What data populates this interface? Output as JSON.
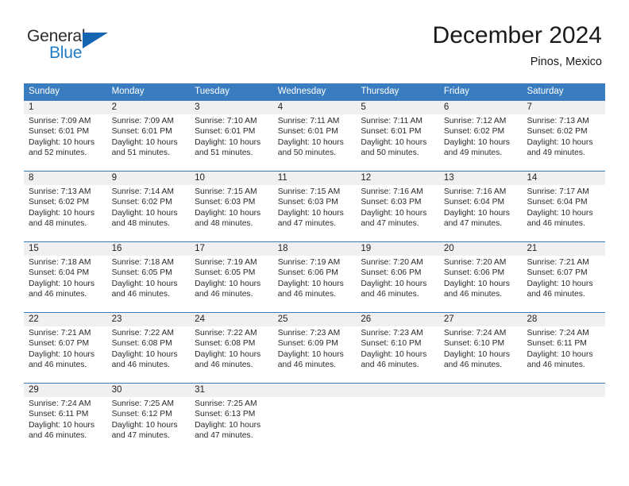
{
  "brand": {
    "name_part1": "General",
    "name_part2": "Blue",
    "triangle_color": "#1565b0",
    "blue_color": "#1f7bc4"
  },
  "header": {
    "title": "December 2024",
    "subtitle": "Pinos, Mexico"
  },
  "theme": {
    "header_blue": "#3a7cc0",
    "daynum_band": "#f0f0f0",
    "text": "#222222"
  },
  "weekdays": [
    "Sunday",
    "Monday",
    "Tuesday",
    "Wednesday",
    "Thursday",
    "Friday",
    "Saturday"
  ],
  "labels": {
    "sunrise_prefix": "Sunrise:",
    "sunset_prefix": "Sunset:",
    "daylight_prefix": "Daylight:"
  },
  "weeks": [
    {
      "days": [
        {
          "num": "1",
          "sunrise": "Sunrise: 7:09 AM",
          "sunset": "Sunset: 6:01 PM",
          "daylight_1": "Daylight: 10 hours",
          "daylight_2": "and 52 minutes."
        },
        {
          "num": "2",
          "sunrise": "Sunrise: 7:09 AM",
          "sunset": "Sunset: 6:01 PM",
          "daylight_1": "Daylight: 10 hours",
          "daylight_2": "and 51 minutes."
        },
        {
          "num": "3",
          "sunrise": "Sunrise: 7:10 AM",
          "sunset": "Sunset: 6:01 PM",
          "daylight_1": "Daylight: 10 hours",
          "daylight_2": "and 51 minutes."
        },
        {
          "num": "4",
          "sunrise": "Sunrise: 7:11 AM",
          "sunset": "Sunset: 6:01 PM",
          "daylight_1": "Daylight: 10 hours",
          "daylight_2": "and 50 minutes."
        },
        {
          "num": "5",
          "sunrise": "Sunrise: 7:11 AM",
          "sunset": "Sunset: 6:01 PM",
          "daylight_1": "Daylight: 10 hours",
          "daylight_2": "and 50 minutes."
        },
        {
          "num": "6",
          "sunrise": "Sunrise: 7:12 AM",
          "sunset": "Sunset: 6:02 PM",
          "daylight_1": "Daylight: 10 hours",
          "daylight_2": "and 49 minutes."
        },
        {
          "num": "7",
          "sunrise": "Sunrise: 7:13 AM",
          "sunset": "Sunset: 6:02 PM",
          "daylight_1": "Daylight: 10 hours",
          "daylight_2": "and 49 minutes."
        }
      ]
    },
    {
      "days": [
        {
          "num": "8",
          "sunrise": "Sunrise: 7:13 AM",
          "sunset": "Sunset: 6:02 PM",
          "daylight_1": "Daylight: 10 hours",
          "daylight_2": "and 48 minutes."
        },
        {
          "num": "9",
          "sunrise": "Sunrise: 7:14 AM",
          "sunset": "Sunset: 6:02 PM",
          "daylight_1": "Daylight: 10 hours",
          "daylight_2": "and 48 minutes."
        },
        {
          "num": "10",
          "sunrise": "Sunrise: 7:15 AM",
          "sunset": "Sunset: 6:03 PM",
          "daylight_1": "Daylight: 10 hours",
          "daylight_2": "and 48 minutes."
        },
        {
          "num": "11",
          "sunrise": "Sunrise: 7:15 AM",
          "sunset": "Sunset: 6:03 PM",
          "daylight_1": "Daylight: 10 hours",
          "daylight_2": "and 47 minutes."
        },
        {
          "num": "12",
          "sunrise": "Sunrise: 7:16 AM",
          "sunset": "Sunset: 6:03 PM",
          "daylight_1": "Daylight: 10 hours",
          "daylight_2": "and 47 minutes."
        },
        {
          "num": "13",
          "sunrise": "Sunrise: 7:16 AM",
          "sunset": "Sunset: 6:04 PM",
          "daylight_1": "Daylight: 10 hours",
          "daylight_2": "and 47 minutes."
        },
        {
          "num": "14",
          "sunrise": "Sunrise: 7:17 AM",
          "sunset": "Sunset: 6:04 PM",
          "daylight_1": "Daylight: 10 hours",
          "daylight_2": "and 46 minutes."
        }
      ]
    },
    {
      "days": [
        {
          "num": "15",
          "sunrise": "Sunrise: 7:18 AM",
          "sunset": "Sunset: 6:04 PM",
          "daylight_1": "Daylight: 10 hours",
          "daylight_2": "and 46 minutes."
        },
        {
          "num": "16",
          "sunrise": "Sunrise: 7:18 AM",
          "sunset": "Sunset: 6:05 PM",
          "daylight_1": "Daylight: 10 hours",
          "daylight_2": "and 46 minutes."
        },
        {
          "num": "17",
          "sunrise": "Sunrise: 7:19 AM",
          "sunset": "Sunset: 6:05 PM",
          "daylight_1": "Daylight: 10 hours",
          "daylight_2": "and 46 minutes."
        },
        {
          "num": "18",
          "sunrise": "Sunrise: 7:19 AM",
          "sunset": "Sunset: 6:06 PM",
          "daylight_1": "Daylight: 10 hours",
          "daylight_2": "and 46 minutes."
        },
        {
          "num": "19",
          "sunrise": "Sunrise: 7:20 AM",
          "sunset": "Sunset: 6:06 PM",
          "daylight_1": "Daylight: 10 hours",
          "daylight_2": "and 46 minutes."
        },
        {
          "num": "20",
          "sunrise": "Sunrise: 7:20 AM",
          "sunset": "Sunset: 6:06 PM",
          "daylight_1": "Daylight: 10 hours",
          "daylight_2": "and 46 minutes."
        },
        {
          "num": "21",
          "sunrise": "Sunrise: 7:21 AM",
          "sunset": "Sunset: 6:07 PM",
          "daylight_1": "Daylight: 10 hours",
          "daylight_2": "and 46 minutes."
        }
      ]
    },
    {
      "days": [
        {
          "num": "22",
          "sunrise": "Sunrise: 7:21 AM",
          "sunset": "Sunset: 6:07 PM",
          "daylight_1": "Daylight: 10 hours",
          "daylight_2": "and 46 minutes."
        },
        {
          "num": "23",
          "sunrise": "Sunrise: 7:22 AM",
          "sunset": "Sunset: 6:08 PM",
          "daylight_1": "Daylight: 10 hours",
          "daylight_2": "and 46 minutes."
        },
        {
          "num": "24",
          "sunrise": "Sunrise: 7:22 AM",
          "sunset": "Sunset: 6:08 PM",
          "daylight_1": "Daylight: 10 hours",
          "daylight_2": "and 46 minutes."
        },
        {
          "num": "25",
          "sunrise": "Sunrise: 7:23 AM",
          "sunset": "Sunset: 6:09 PM",
          "daylight_1": "Daylight: 10 hours",
          "daylight_2": "and 46 minutes."
        },
        {
          "num": "26",
          "sunrise": "Sunrise: 7:23 AM",
          "sunset": "Sunset: 6:10 PM",
          "daylight_1": "Daylight: 10 hours",
          "daylight_2": "and 46 minutes."
        },
        {
          "num": "27",
          "sunrise": "Sunrise: 7:24 AM",
          "sunset": "Sunset: 6:10 PM",
          "daylight_1": "Daylight: 10 hours",
          "daylight_2": "and 46 minutes."
        },
        {
          "num": "28",
          "sunrise": "Sunrise: 7:24 AM",
          "sunset": "Sunset: 6:11 PM",
          "daylight_1": "Daylight: 10 hours",
          "daylight_2": "and 46 minutes."
        }
      ]
    },
    {
      "days": [
        {
          "num": "29",
          "sunrise": "Sunrise: 7:24 AM",
          "sunset": "Sunset: 6:11 PM",
          "daylight_1": "Daylight: 10 hours",
          "daylight_2": "and 46 minutes."
        },
        {
          "num": "30",
          "sunrise": "Sunrise: 7:25 AM",
          "sunset": "Sunset: 6:12 PM",
          "daylight_1": "Daylight: 10 hours",
          "daylight_2": "and 47 minutes."
        },
        {
          "num": "31",
          "sunrise": "Sunrise: 7:25 AM",
          "sunset": "Sunset: 6:13 PM",
          "daylight_1": "Daylight: 10 hours",
          "daylight_2": "and 47 minutes."
        },
        {
          "num": "",
          "sunrise": "",
          "sunset": "",
          "daylight_1": "",
          "daylight_2": ""
        },
        {
          "num": "",
          "sunrise": "",
          "sunset": "",
          "daylight_1": "",
          "daylight_2": ""
        },
        {
          "num": "",
          "sunrise": "",
          "sunset": "",
          "daylight_1": "",
          "daylight_2": ""
        },
        {
          "num": "",
          "sunrise": "",
          "sunset": "",
          "daylight_1": "",
          "daylight_2": ""
        }
      ]
    }
  ]
}
